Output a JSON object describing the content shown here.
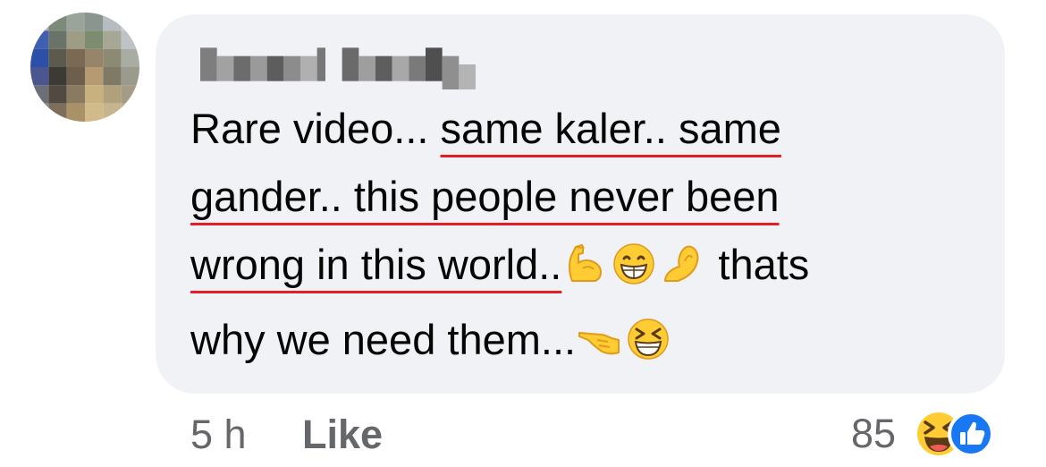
{
  "comment": {
    "author": "",
    "line1_a": "Rare video... ",
    "line1_b": "same kaler.. same",
    "line2": "gander.. this people never been",
    "line3_a": "wrong in this world..",
    "line3_b": " thats",
    "line4": "why we need them...",
    "emojis": [
      "flexed-biceps-icon",
      "grinning-face-icon",
      "pinching-hand-icon",
      "backhand-pointing-left-icon",
      "squinting-laughing-face-icon"
    ]
  },
  "actions": {
    "time": "5 h",
    "like": "Like"
  },
  "reactions": {
    "count": "85",
    "icons": [
      "haha-reaction-icon",
      "like-reaction-icon"
    ]
  },
  "colors": {
    "bubble": "#f0f2f5",
    "text": "#050505",
    "meta": "#65676b",
    "spellcheck": "#e41e26",
    "like_blue": "#1877f2",
    "emoji_yellow": "#ffcc33"
  }
}
